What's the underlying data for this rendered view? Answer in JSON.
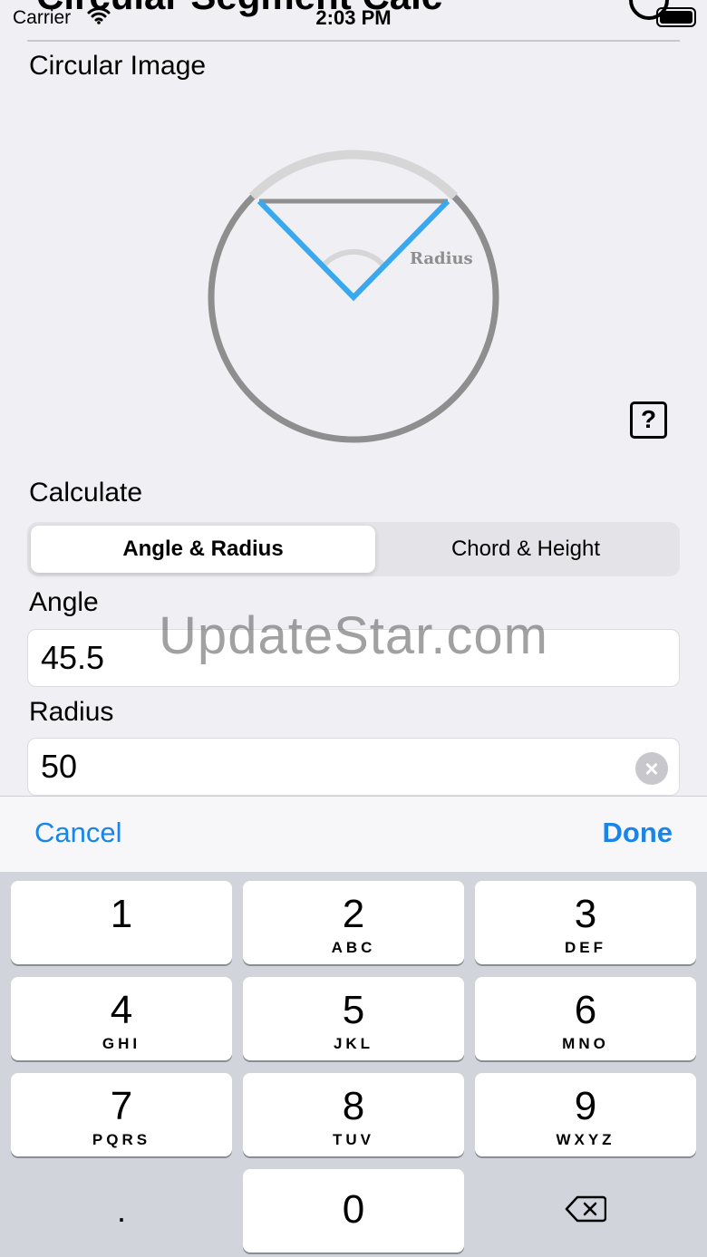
{
  "nav": {
    "title": "Circular Segment Calc"
  },
  "status_bar": {
    "carrier": "Carrier",
    "time": "2:03 PM"
  },
  "circular_image": {
    "label": "Circular Image",
    "diagram_label": "Radius",
    "help_label": "?"
  },
  "calculate": {
    "label": "Calculate",
    "options": [
      "Angle & Radius",
      "Chord & Height"
    ],
    "selected_index": 0
  },
  "angle": {
    "label": "Angle",
    "value": "45.5"
  },
  "radius": {
    "label": "Radius",
    "value": "50"
  },
  "watermark": "UpdateStar.com",
  "toolbar": {
    "cancel_label": "Cancel",
    "done_label": "Done"
  },
  "keypad": {
    "keys": [
      {
        "num": "1",
        "letters": ""
      },
      {
        "num": "2",
        "letters": "ABC"
      },
      {
        "num": "3",
        "letters": "DEF"
      },
      {
        "num": "4",
        "letters": "GHI"
      },
      {
        "num": "5",
        "letters": "JKL"
      },
      {
        "num": "6",
        "letters": "MNO"
      },
      {
        "num": "7",
        "letters": "PQRS"
      },
      {
        "num": "8",
        "letters": "TUV"
      },
      {
        "num": "9",
        "letters": "WXYZ"
      },
      {
        "num": "0",
        "letters": ""
      }
    ],
    "decimal": "."
  },
  "colors": {
    "accent": "#1a84e8",
    "diagram_blue": "#3aa8ee",
    "diagram_gray": "#8e8e8e",
    "diagram_light": "#d6d6d6"
  }
}
